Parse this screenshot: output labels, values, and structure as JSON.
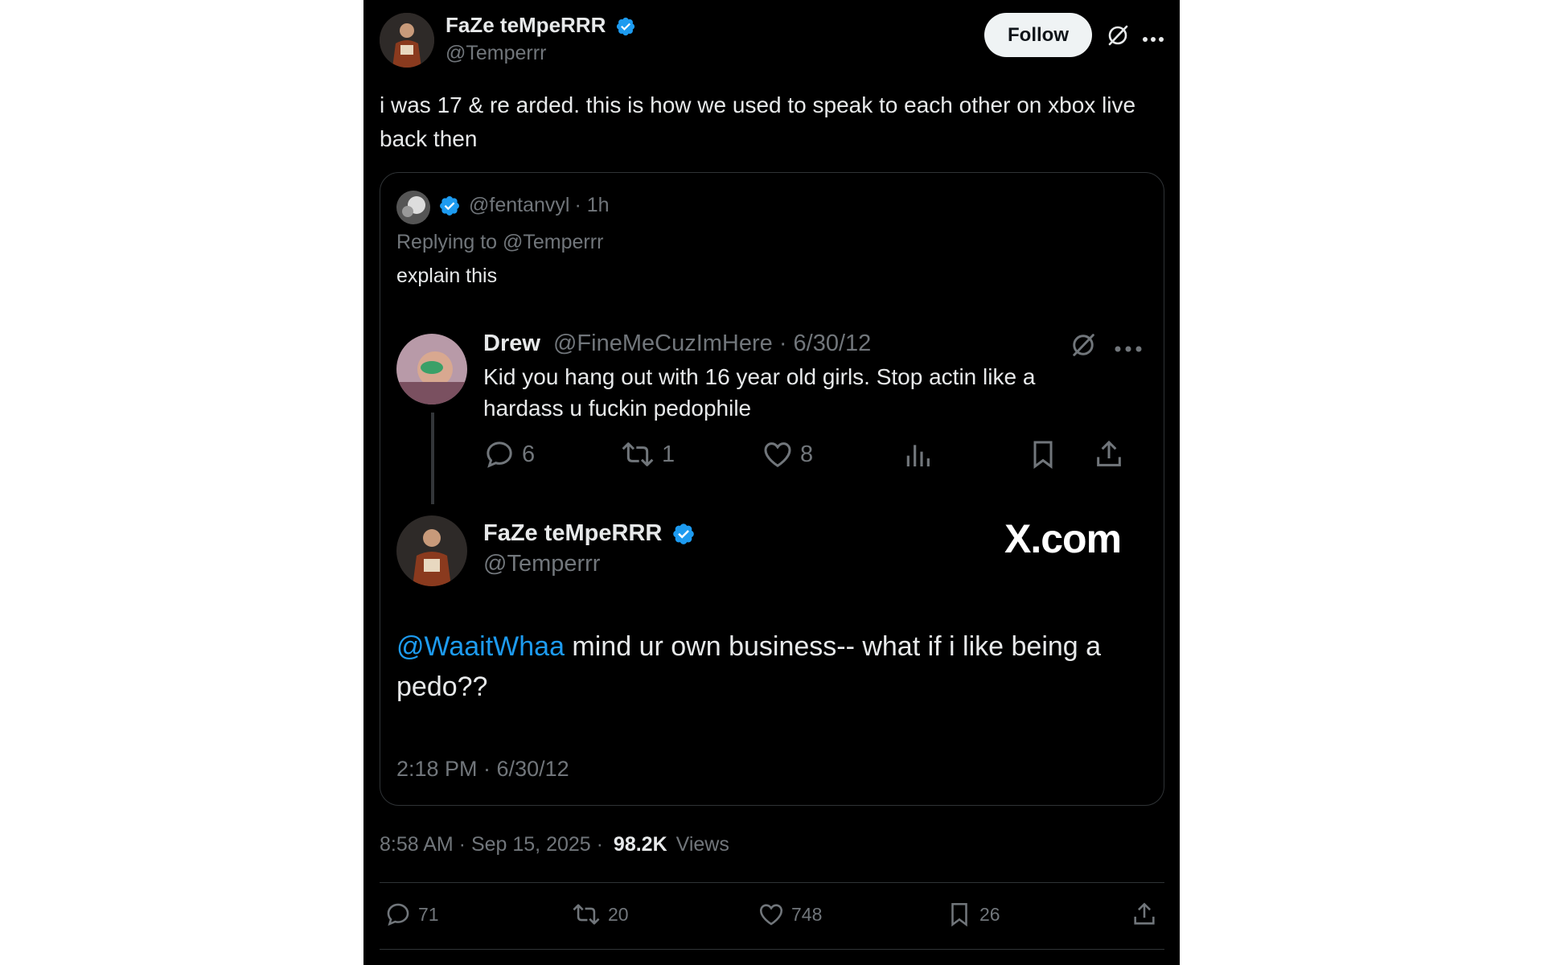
{
  "header": {
    "display_name": "FaZe teMpeRRR",
    "handle": "@Temperrr",
    "follow_label": "Follow"
  },
  "tweet": {
    "text": "i was 17 & re  arded. this is how we used to speak to each other on xbox live back then",
    "timestamp": "8:58 AM · Sep 15, 2025 ·",
    "views_count": "98.2K",
    "views_label": "Views"
  },
  "quoted": {
    "handle": "@fentanvyl",
    "time": "· 1h",
    "replying_to": "Replying to @Temperrr",
    "text": "explain this",
    "reply": {
      "name": "Drew",
      "handle_date": "@FineMeCuzImHere · 6/30/12",
      "text": "Kid you hang out with 16 year old girls. Stop actin like a hardass u fuckin pedophile",
      "replies": "6",
      "retweets": "1",
      "likes": "8"
    },
    "main": {
      "name": "FaZe teMpeRRR",
      "handle": "@Temperrr",
      "watermark": "X.com",
      "mention": "@WaaitWhaa",
      "text": " mind ur own business-- what if i like being a pedo??",
      "timestamp": "2:18 PM · 6/30/12"
    }
  },
  "actions": {
    "replies": "71",
    "retweets": "20",
    "likes": "748",
    "bookmarks": "26"
  },
  "colors": {
    "background": "#000000",
    "text": "#e7e9ea",
    "muted": "#71767b",
    "accent": "#1d9bf0",
    "border": "#2f3336"
  },
  "icons": [
    "verified-badge-icon",
    "grok-icon",
    "more-icon",
    "reply-icon",
    "retweet-icon",
    "like-icon",
    "analytics-icon",
    "bookmark-icon",
    "share-icon"
  ]
}
